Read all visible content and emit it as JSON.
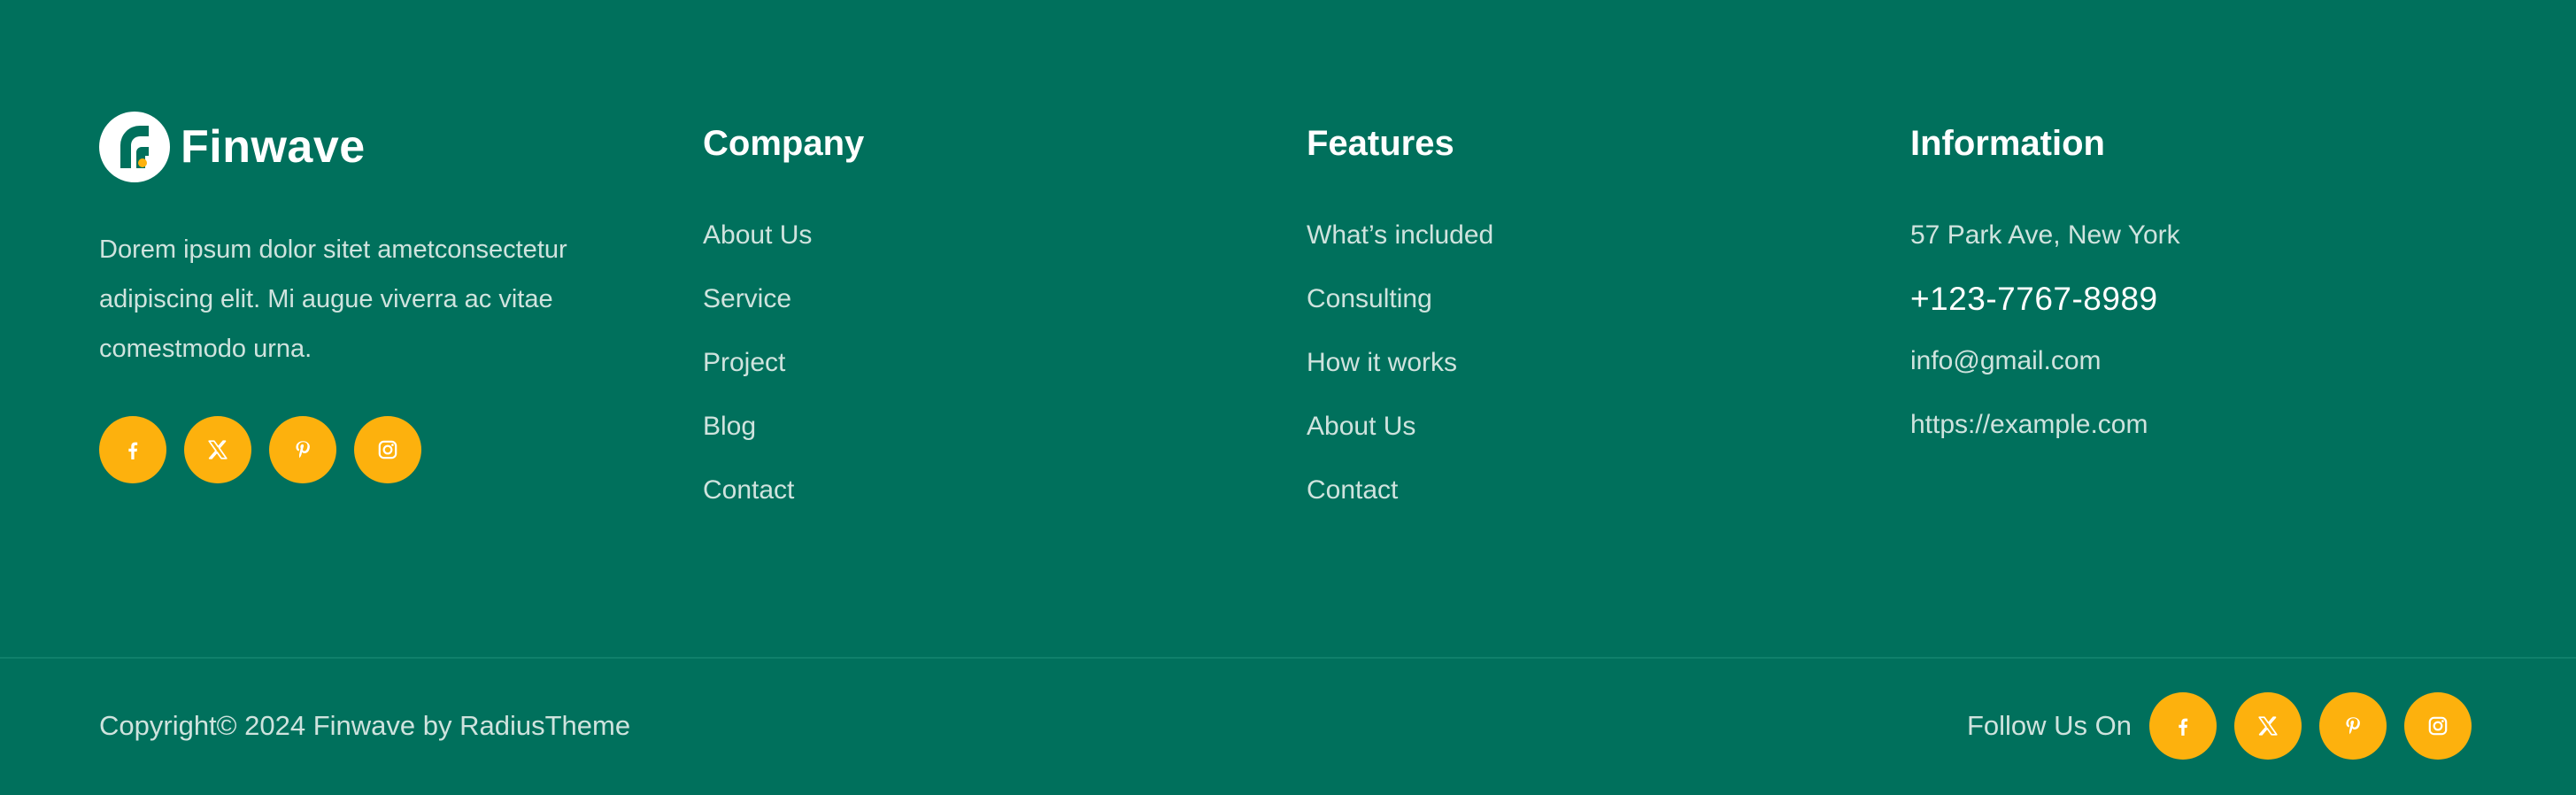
{
  "brand": {
    "name": "Finwave",
    "description": "Dorem ipsum dolor sitet ametconsectetur adipiscing elit. Mi augue viverra ac vitae comestmodo urna."
  },
  "colors": {
    "background": "#00705c",
    "accent": "#fdb10d",
    "text_muted": "#cfe3de",
    "heading": "#ffffff"
  },
  "socials": [
    {
      "icon": "facebook-icon"
    },
    {
      "icon": "x-icon"
    },
    {
      "icon": "pinterest-icon"
    },
    {
      "icon": "instagram-icon"
    }
  ],
  "company": {
    "title": "Company",
    "links": [
      "About Us",
      "Service",
      "Project",
      "Blog",
      "Contact"
    ]
  },
  "features": {
    "title": "Features",
    "links": [
      "What’s included",
      "Consulting",
      "How it works",
      "About Us",
      "Contact"
    ]
  },
  "information": {
    "title": "Information",
    "address": "57 Park Ave, New York",
    "phone": "+123-7767-8989",
    "email": "info@gmail.com",
    "website": "https://example.com"
  },
  "bottom": {
    "copyright": "Copyright© 2024 Finwave by RadiusTheme",
    "follow_label": "Follow Us On"
  }
}
